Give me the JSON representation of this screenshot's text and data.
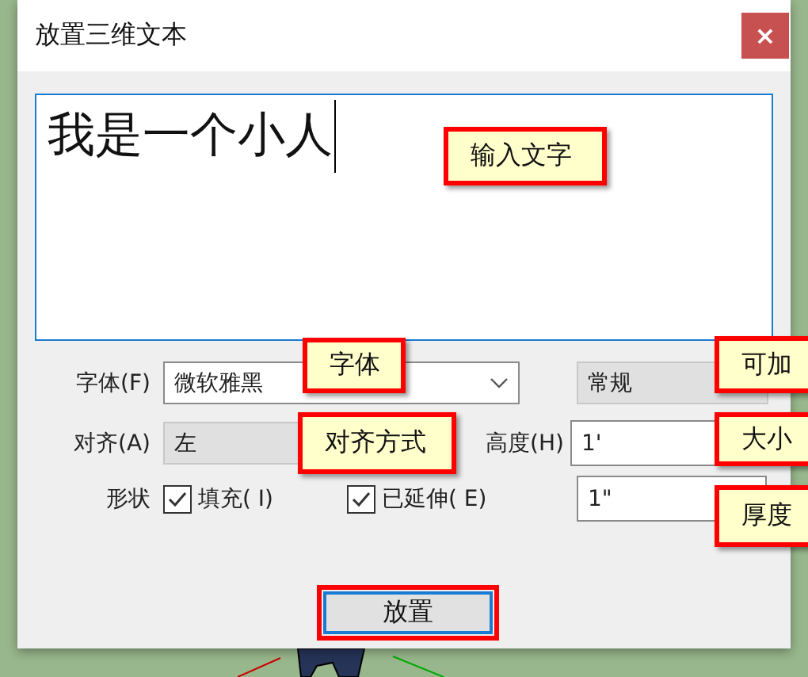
{
  "window": {
    "title": "放置三维文本",
    "close": "×"
  },
  "text_input": {
    "value": "我是一个小人"
  },
  "font": {
    "label": "字体(F)",
    "value": "微软雅黑"
  },
  "style": {
    "value": "常规",
    "disabled": true
  },
  "align": {
    "label": "对齐(A)",
    "value": "左",
    "disabled": true
  },
  "height": {
    "label": "高度(H)",
    "value": "1'",
    "disabled": false
  },
  "shape": {
    "label": "形状",
    "checkboxes": [
      {
        "label": "填充( I)",
        "checked": true
      },
      {
        "label": "已延伸( E)",
        "checked": true
      }
    ]
  },
  "extrusion": {
    "value": "1\"",
    "disabled": false
  },
  "place_button": {
    "label": "放置",
    "outlined": true
  },
  "callouts": [
    {
      "text": "输入文字"
    },
    {
      "text": "字体"
    },
    {
      "text": "可加"
    },
    {
      "text": "对齐方式"
    },
    {
      "text": "大小"
    },
    {
      "text": "厚度"
    }
  ]
}
